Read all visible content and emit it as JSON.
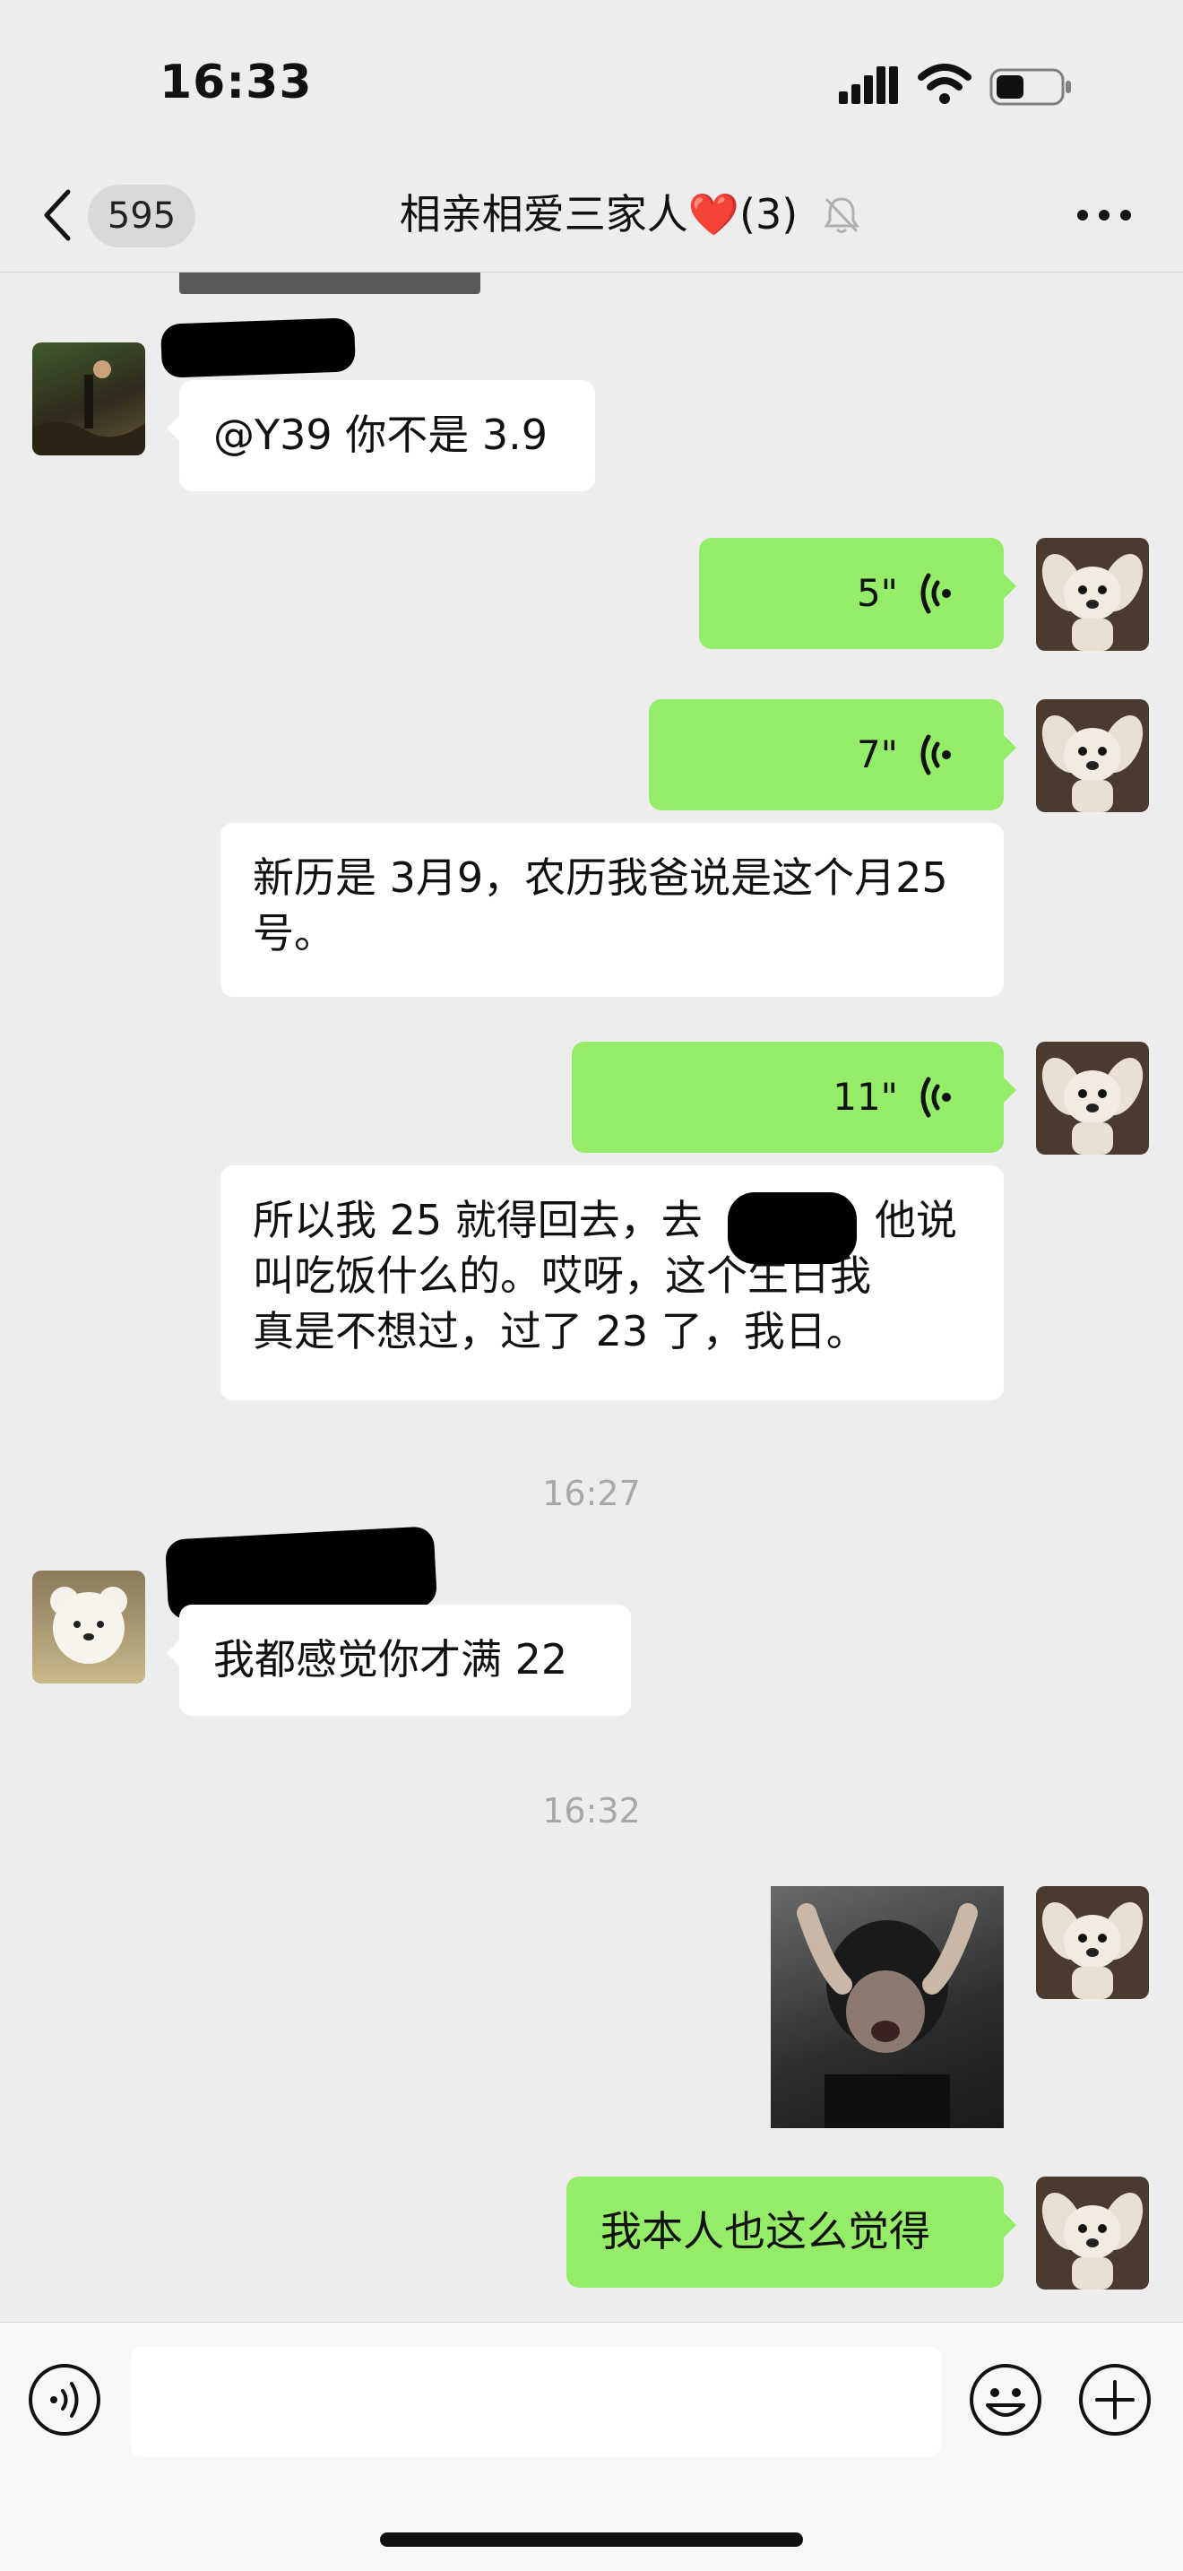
{
  "status_bar": {
    "time": "16:33"
  },
  "nav": {
    "back_badge": "595",
    "title_text": "相亲相爱三家人",
    "title_heart": "❤️",
    "title_count": "(3)"
  },
  "messages": {
    "m1_text": "@Y39 你不是 3.9",
    "m2_voice_length": "5\"",
    "m3_voice_length": "7\"",
    "m4_text": "新历是 3月9，农历我爸说是这个月25号。",
    "m5_voice_length": "11\"",
    "m6_text_a": "所以我 25 就得回去，去",
    "m6_text_b": "他说",
    "m6_text_c": "叫吃饭什么的。哎呀，这个生日我",
    "m6_text_d": "真是不想过，过了 23 了，我日。",
    "time_1": "16:27",
    "m7_text": "我都感觉你才满 22",
    "time_2": "16:32",
    "m9_text": "我本人也这么觉得"
  },
  "input": {
    "placeholder": ""
  },
  "colors": {
    "background": "#ededed",
    "my_bubble": "#95ec69",
    "their_bubble": "#ffffff",
    "timestamp": "#a8a8a8"
  },
  "icons": [
    "cellular-signal-icon",
    "wifi-icon",
    "battery-icon",
    "back-chevron-icon",
    "mute-bell-icon",
    "more-dots-icon",
    "voice-wave-icon",
    "voice-input-icon",
    "emoji-icon",
    "plus-icon"
  ]
}
